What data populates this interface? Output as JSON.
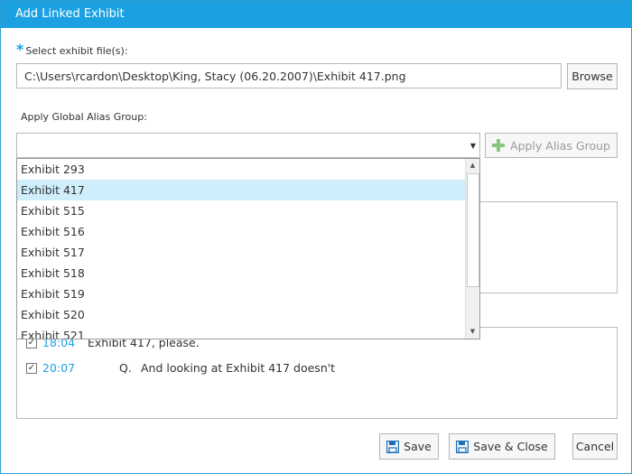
{
  "window": {
    "title": "Add Linked Exhibit"
  },
  "file_section": {
    "required_mark": "*",
    "label": "Select exhibit file(s):",
    "path_value": "C:\\Users\\rcardon\\Desktop\\King, Stacy (06.20.2007)\\Exhibit 417.png",
    "browse_label": "Browse"
  },
  "alias_section": {
    "label": "Apply Global Alias Group:",
    "selected_value": "",
    "apply_button_label": "Apply Alias Group"
  },
  "dropdown": {
    "items": [
      "Exhibit 293",
      "Exhibit 417",
      "Exhibit 515",
      "Exhibit 516",
      "Exhibit 517",
      "Exhibit 518",
      "Exhibit 519",
      "Exhibit 520",
      "Exhibit 521"
    ],
    "highlighted_index": 1
  },
  "lines": [
    {
      "checked": true,
      "time": "18:04",
      "speaker": "",
      "text": "Exhibit 417, please."
    },
    {
      "checked": true,
      "time": "20:07",
      "speaker": "Q.",
      "text": "And looking at Exhibit 417 doesn't"
    }
  ],
  "footer": {
    "save_label": "Save",
    "save_close_label": "Save & Close",
    "cancel_label": "Cancel"
  },
  "colors": {
    "accent": "#1ba1e2",
    "highlight": "#cdeefa",
    "apply_icon": "#86c77b",
    "save_icon": "#1c6fb8"
  }
}
